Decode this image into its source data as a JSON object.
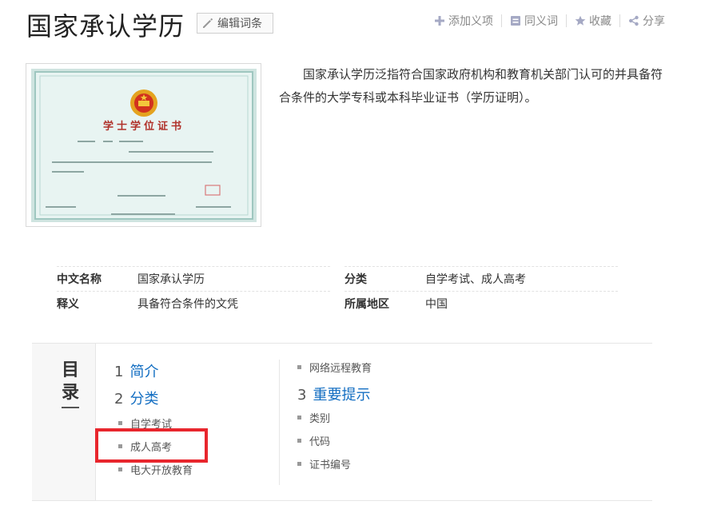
{
  "header": {
    "title": "国家承认学历",
    "edit_label": "编辑词条",
    "toolbar": [
      {
        "label": "添加义项",
        "icon": "plus-icon"
      },
      {
        "label": "同义词",
        "icon": "synonym-icon"
      },
      {
        "label": "收藏",
        "icon": "star-icon"
      },
      {
        "label": "分享",
        "icon": "share-icon"
      }
    ]
  },
  "image": {
    "cert_title": "学士学位证书",
    "icon": "national-emblem-icon"
  },
  "summary": "国家承认学历泛指符合国家政府机构和教育机关部门认可的并具备符合条件的大学专科或本科毕业证书（学历证明）。",
  "basic_info": {
    "left": [
      {
        "key": "中文名称",
        "value": "国家承认学历"
      },
      {
        "key": "释义",
        "value": "具备符合条件的文凭"
      }
    ],
    "right": [
      {
        "key": "分类",
        "value": "自学考试、成人高考"
      },
      {
        "key": "所属地区",
        "value": "中国"
      }
    ]
  },
  "toc": {
    "title": "目录",
    "col1": [
      {
        "num": "1",
        "label": "简介"
      },
      {
        "num": "2",
        "label": "分类"
      },
      {
        "label": "自学考试"
      },
      {
        "label": "成人高考"
      },
      {
        "label": "电大开放教育"
      }
    ],
    "col2": [
      {
        "label": "网络远程教育"
      },
      {
        "num": "3",
        "label": "重要提示"
      },
      {
        "label": "类别"
      },
      {
        "label": "代码"
      },
      {
        "label": "证书编号"
      }
    ]
  },
  "colors": {
    "link": "#136ec2",
    "highlight": "#e8262d"
  }
}
